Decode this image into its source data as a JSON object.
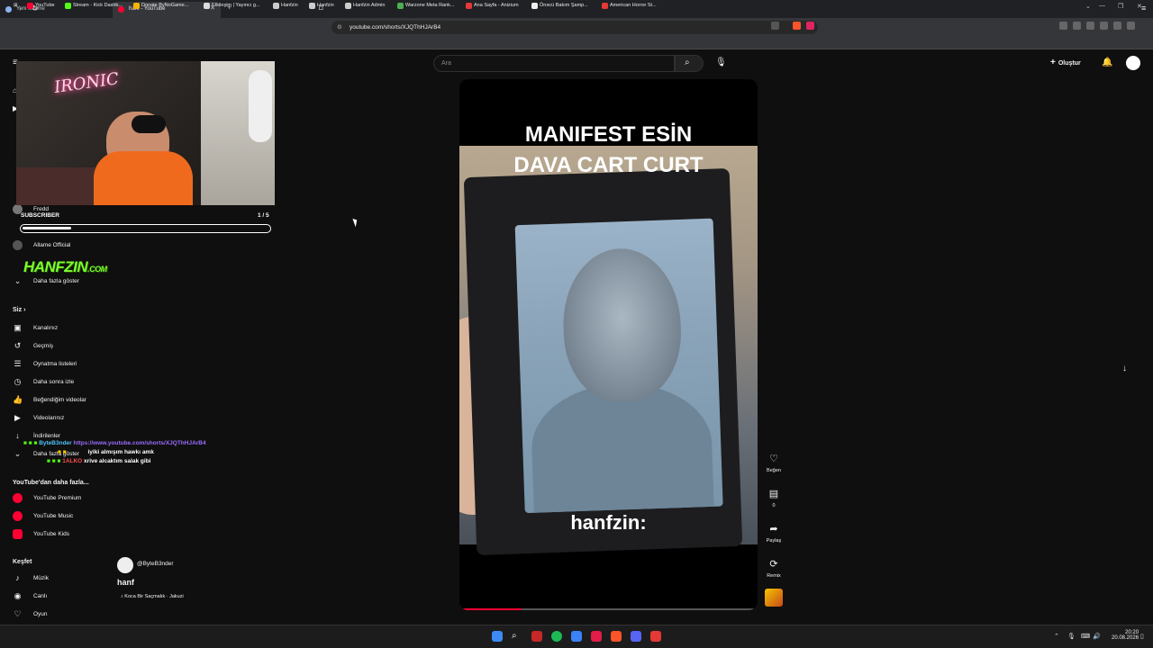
{
  "browser": {
    "tabs": [
      {
        "label": "Yeni Sekme"
      },
      {
        "label": "hanf - YouTube"
      }
    ],
    "url": "youtube.com/shorts/XJQThHJArB4",
    "bookmarks": [
      "YouTube",
      "Stream - Kick Dashb...",
      "Donate ByNoGame...",
      "Etkileşim | Yayıncı g...",
      "Hanfzin",
      "Hanfzin",
      "Hanfzin Admin",
      "Warzone Meta Rank...",
      "Ana Sayfa - Anizium",
      "Önəcü Bakım Şamp...",
      "American Horror St..."
    ]
  },
  "youtube": {
    "search_placeholder": "Ara",
    "create_label": "Oluştur",
    "sidebar": {
      "subs_visible": [
        {
          "label": "Fredd"
        },
        {
          "label": "Allame Official"
        }
      ],
      "show_more": "Daha fazla göster",
      "you_header": "Siz",
      "you_items": [
        {
          "label": "Kanalınız",
          "icon": "channel-icon"
        },
        {
          "label": "Geçmiş",
          "icon": "history-icon"
        },
        {
          "label": "Oynatma listeleri",
          "icon": "playlist-icon"
        },
        {
          "label": "Daha sonra izle",
          "icon": "clock-icon"
        },
        {
          "label": "Beğendiğim videolar",
          "icon": "thumbs-up-icon"
        },
        {
          "label": "Videolarınız",
          "icon": "video-icon"
        },
        {
          "label": "İndirilenler",
          "icon": "download-icon"
        },
        {
          "label": "Daha fazla göster",
          "icon": "chevron-down-icon"
        }
      ],
      "more_header": "YouTube'dan daha fazla...",
      "more_items": [
        {
          "label": "YouTube Premium"
        },
        {
          "label": "YouTube Music"
        },
        {
          "label": "YouTube Kids"
        }
      ],
      "explore_header": "Keşfet",
      "explore_items": [
        {
          "label": "Müzik",
          "icon": "music-icon"
        },
        {
          "label": "Canlı",
          "icon": "live-icon"
        },
        {
          "label": "Oyun",
          "icon": "gaming-icon"
        }
      ]
    },
    "short": {
      "title_line1": "MANIFEST ESİN",
      "title_line2": "DAVA CART CURT",
      "caption": "hanfzin:",
      "channel": "@ByteB3nder",
      "video_title": "hanf",
      "sound": "Koca Bir Saçmalık · Jakuzi",
      "progress": 0.2,
      "actions": {
        "like": "Beğen",
        "comments": "0",
        "share": "Paylaş",
        "remix": "Remix"
      }
    }
  },
  "overlay": {
    "neon_sign": "IRONIC",
    "subscriber_label": "SUBSCRIBER",
    "subscriber_count": "1 / 5",
    "subscriber_progress": 0.2,
    "brand": "HANFZIN",
    "brand_suffix": ".COM",
    "chat": [
      {
        "user": "ByteB3nder",
        "message": "https://www.youtube.com/shorts/XJQThHJArB4",
        "user_color": "#4fc3f7",
        "msg_color": "#9b6cff"
      },
      {
        "user": "",
        "message": "iyiki almışım hawkı amk",
        "user_color": "#ff4d4d",
        "msg_color": "#ffffff"
      },
      {
        "user": "1ALKO",
        "message": "xrive alcaktım salak gibi",
        "user_color": "#ff4d4d",
        "msg_color": "#ffffff"
      }
    ]
  },
  "system": {
    "time": "20:20",
    "date": "20.08.2026"
  }
}
